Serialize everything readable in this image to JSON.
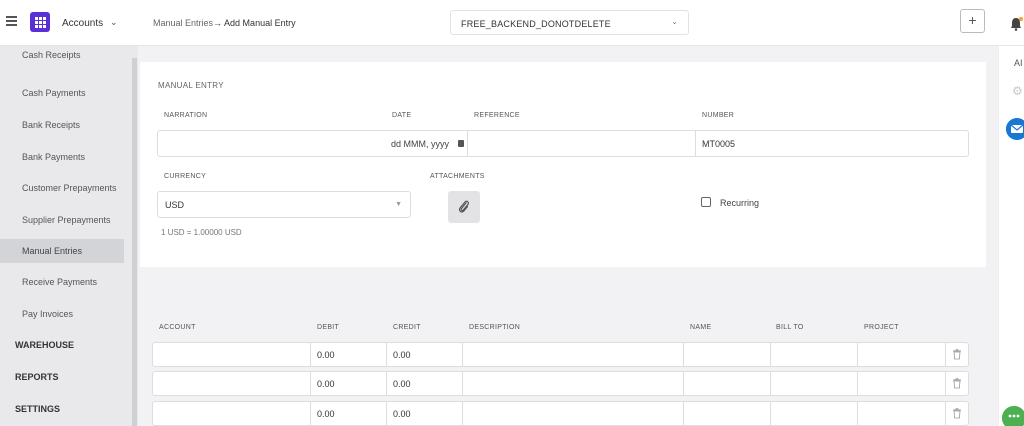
{
  "header": {
    "app_name": "Accounts",
    "breadcrumb_parent": "Manual Entries",
    "breadcrumb_arrow": "→",
    "breadcrumb_current": "Add Manual Entry",
    "organization": "FREE_BACKEND_DONOTDELETE",
    "add_label": "+"
  },
  "sidebar": {
    "items": [
      {
        "label": "Cash Receipts"
      },
      {
        "label": "Cash Payments"
      },
      {
        "label": "Bank Receipts"
      },
      {
        "label": "Bank Payments"
      },
      {
        "label": "Customer Prepayments"
      },
      {
        "label": "Supplier Prepayments"
      },
      {
        "label": "Manual Entries",
        "active": true
      },
      {
        "label": "Receive Payments"
      },
      {
        "label": "Pay Invoices"
      }
    ],
    "sections": [
      "WAREHOUSE",
      "REPORTS",
      "SETTINGS"
    ]
  },
  "right_rail": {
    "text": "AI"
  },
  "form": {
    "title": "MANUAL ENTRY",
    "labels": {
      "narration": "NARRATION",
      "date": "DATE",
      "reference": "REFERENCE",
      "number": "NUMBER",
      "currency": "CURRENCY",
      "attachments": "ATTACHMENTS"
    },
    "date_placeholder": "dd MMM, yyyy",
    "number_value": "MT0005",
    "currency_value": "USD",
    "exchange_rate": "1 USD = 1.00000 USD",
    "recurring_label": "Recurring"
  },
  "lines": {
    "columns": [
      "ACCOUNT",
      "DEBIT",
      "CREDIT",
      "DESCRIPTION",
      "NAME",
      "BILL TO",
      "PROJECT"
    ],
    "rows": [
      {
        "debit": "0.00",
        "credit": "0.00"
      },
      {
        "debit": "0.00",
        "credit": "0.00"
      },
      {
        "debit": "0.00",
        "credit": "0.00"
      }
    ]
  },
  "icons": {
    "menu": "hamburger-icon",
    "logo": "grid-logo-icon",
    "bell": "bell-icon",
    "calendar": "calendar-icon",
    "attach": "paperclip-icon",
    "trash": "trash-icon",
    "gear": "gear-icon",
    "mail": "mail-icon",
    "chat": "chat-icon"
  },
  "colors": {
    "brand": "#5b2fd6",
    "mail": "#1976d2",
    "chat": "#4caf50"
  }
}
